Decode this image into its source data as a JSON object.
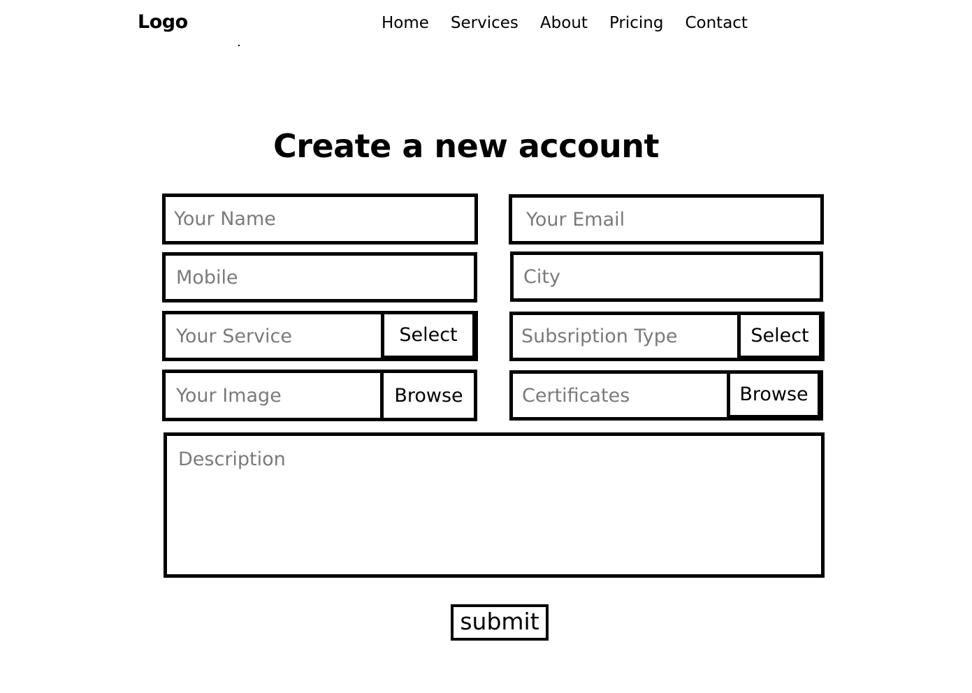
{
  "header": {
    "logo": "Logo",
    "nav": [
      "Home",
      "Services",
      "About",
      "Pricing",
      "Contact"
    ]
  },
  "form": {
    "title": "Create a new account",
    "name_placeholder": "Your Name",
    "email_placeholder": "Your Email",
    "mobile_placeholder": "Mobile",
    "city_placeholder": "City",
    "service_placeholder": "Your Service",
    "service_button": "Select",
    "subscription_placeholder": "Subsription Type",
    "subscription_button": "Select",
    "image_placeholder": "Your Image",
    "image_button": "Browse",
    "certificates_placeholder": "Certificates",
    "certificates_button": "Browse",
    "description_placeholder": "Description",
    "submit_label": "submit"
  }
}
